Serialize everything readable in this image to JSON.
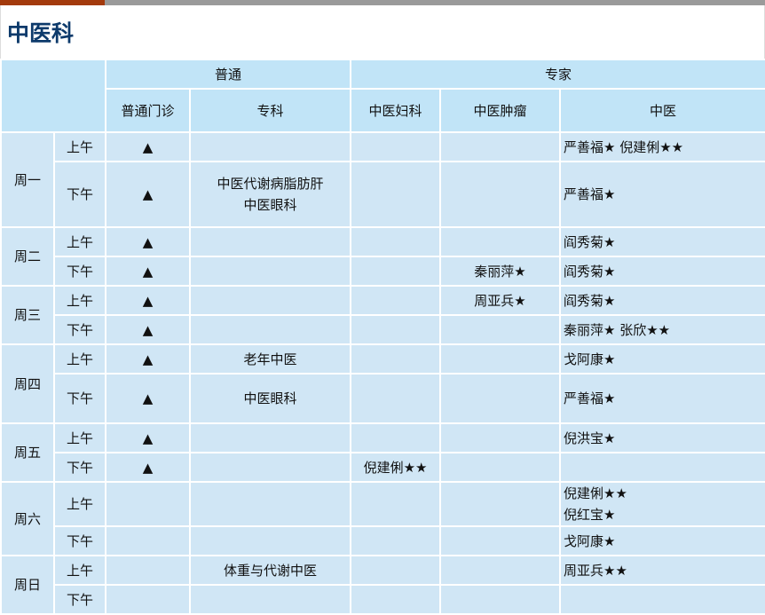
{
  "title": "中医科",
  "header": {
    "general": "普通",
    "expert": "专家",
    "cols": [
      "普通门诊",
      "专科",
      "中医妇科",
      "中医肿瘤",
      "中医"
    ]
  },
  "rows": [
    {
      "day": "周一",
      "period": "上午",
      "general": "▲",
      "special": "",
      "gyn": "",
      "onc": "",
      "tcm": "严善福★  倪建俐★★"
    },
    {
      "period": "下午",
      "general": "▲",
      "special": "中医代谢病脂肪肝\n中医眼科",
      "gyn": "",
      "onc": "",
      "tcm": "严善福★"
    },
    {
      "day": "周二",
      "period": "上午",
      "general": "▲",
      "special": "",
      "gyn": "",
      "onc": "",
      "tcm": "阎秀菊★"
    },
    {
      "period": "下午",
      "general": "▲",
      "special": "",
      "gyn": "",
      "onc": "秦丽萍★",
      "tcm": "阎秀菊★"
    },
    {
      "day": "周三",
      "period": "上午",
      "general": "▲",
      "special": "",
      "gyn": "",
      "onc": "周亚兵★",
      "tcm": "阎秀菊★"
    },
    {
      "period": "下午",
      "general": "▲",
      "special": "",
      "gyn": "",
      "onc": "",
      "tcm": "秦丽萍★  张欣★★"
    },
    {
      "day": "周四",
      "period": "上午",
      "general": "▲",
      "special": "老年中医",
      "gyn": "",
      "onc": "",
      "tcm": "戈阿康★"
    },
    {
      "period": "下午",
      "general": "▲",
      "special": "中医眼科",
      "gyn": "",
      "onc": "",
      "tcm": "严善福★"
    },
    {
      "day": "周五",
      "period": "上午",
      "general": "▲",
      "special": "",
      "gyn": "",
      "onc": "",
      "tcm": "倪洪宝★"
    },
    {
      "period": "下午",
      "general": "▲",
      "special": "",
      "gyn": "倪建俐★★",
      "onc": "",
      "tcm": ""
    },
    {
      "day": "周六",
      "period": "上午",
      "general": "",
      "special": "",
      "gyn": "",
      "onc": "",
      "tcm": "倪建俐★★\n倪红宝★"
    },
    {
      "period": "下午",
      "general": "",
      "special": "",
      "gyn": "",
      "onc": "",
      "tcm": "戈阿康★"
    },
    {
      "day": "周日",
      "period": "上午",
      "general": "",
      "special": "体重与代谢中医",
      "gyn": "",
      "onc": "",
      "tcm": "周亚兵★★"
    },
    {
      "period": "下午",
      "general": "",
      "special": "",
      "gyn": "",
      "onc": "",
      "tcm": ""
    }
  ]
}
